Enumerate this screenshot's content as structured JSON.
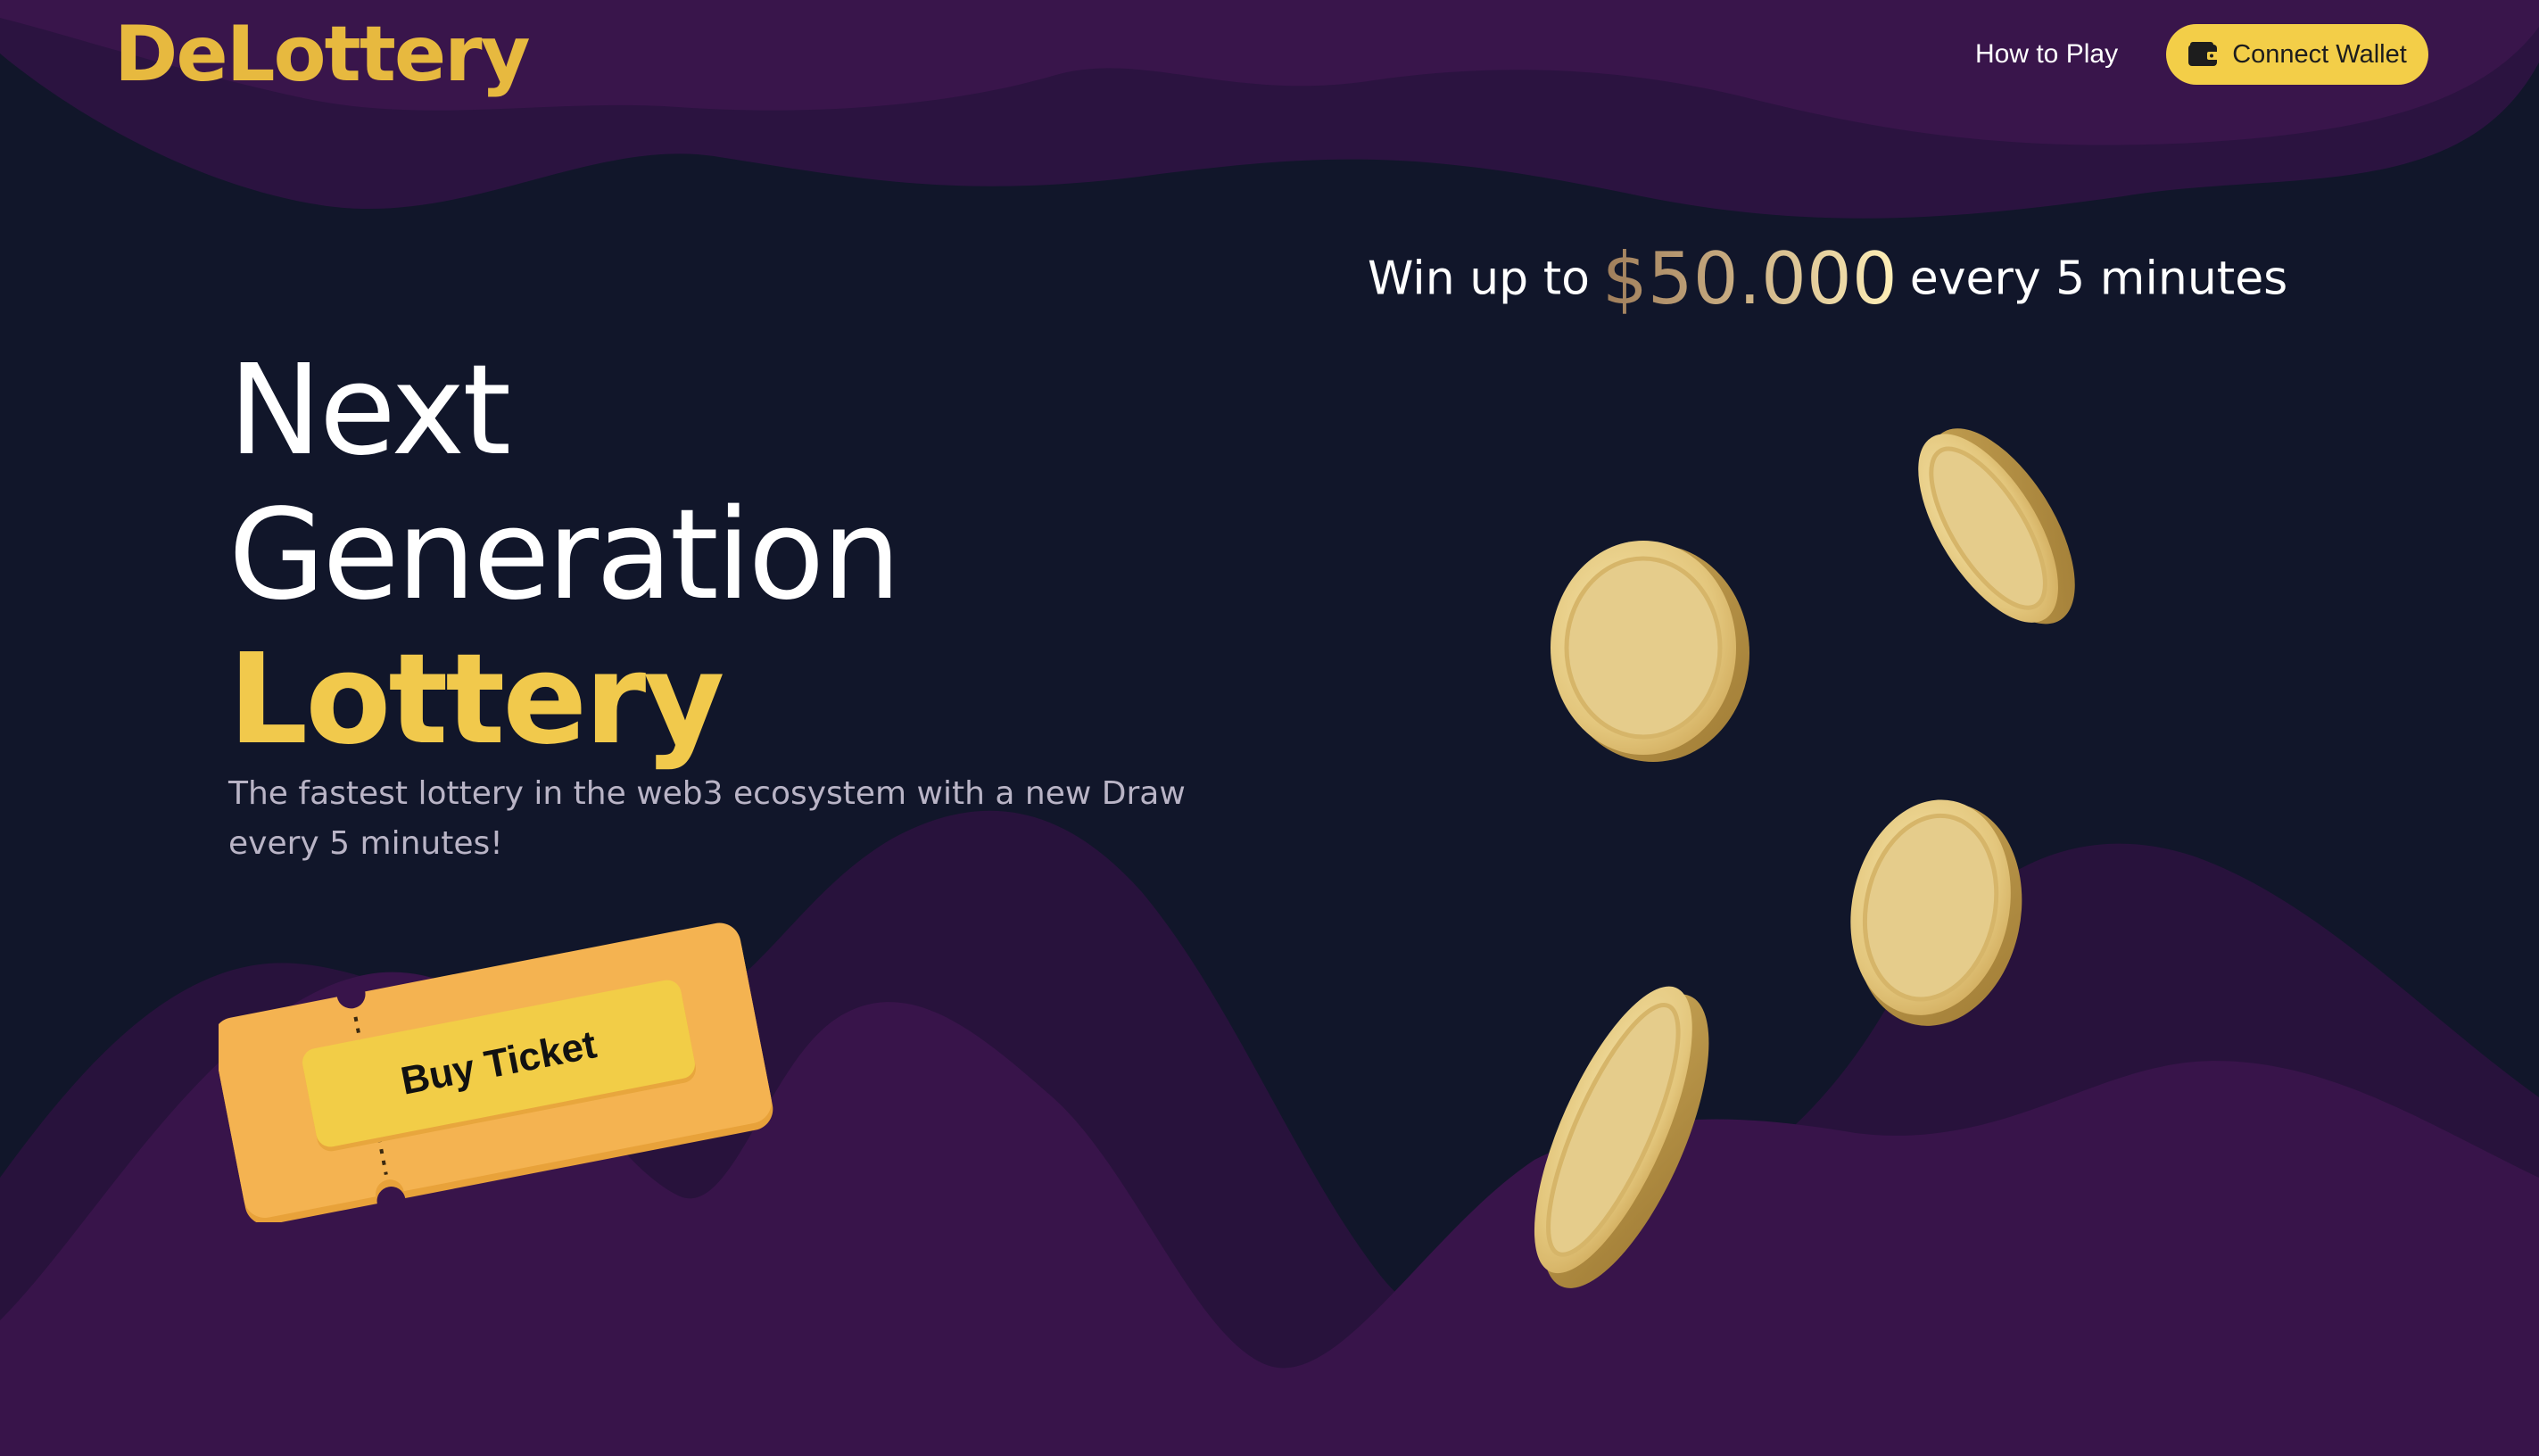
{
  "header": {
    "logo": "DeLottery",
    "nav_link": "How to Play",
    "wallet_button": {
      "label": "Connect Wallet",
      "icon": "wallet-icon"
    }
  },
  "hero": {
    "headline": {
      "line1": "Next",
      "line2": "Generation",
      "line3": "Lottery"
    },
    "subtitle": "The fastest lottery in the web3 ecosystem with a new Draw every 5 minutes!",
    "buy_button": "Buy Ticket"
  },
  "promo": {
    "prefix": "Win up to",
    "amount": "$50.000",
    "suffix": "every 5 minutes"
  },
  "colors": {
    "background": "#11162a",
    "wave_purple": "#38144a",
    "accent_gold": "#f3ce48",
    "ticket_orange": "#f4b351"
  }
}
